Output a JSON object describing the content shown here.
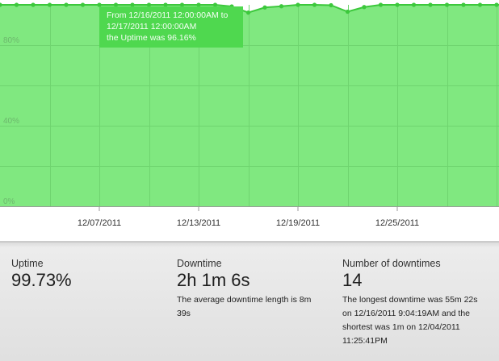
{
  "chart_data": {
    "type": "area",
    "ylabel_ticks": [
      "0%",
      "40%",
      "80%"
    ],
    "ylim": [
      0,
      100
    ],
    "x_tick_labels": [
      "12/07/2011",
      "12/13/2011",
      "12/19/2011",
      "12/25/2011"
    ],
    "x_tick_days": [
      7,
      13,
      19,
      25
    ],
    "x_dates_day_of_december_2011": [
      1,
      2,
      3,
      4,
      5,
      6,
      7,
      8,
      9,
      10,
      11,
      12,
      13,
      14,
      15,
      16,
      17,
      18,
      19,
      20,
      21,
      22,
      23,
      24,
      25,
      26,
      27,
      28,
      29,
      30,
      31
    ],
    "uptime_percent": [
      100,
      100,
      100,
      99.99,
      100,
      100,
      100,
      100,
      100,
      100,
      100,
      100,
      100,
      100,
      99.2,
      96.16,
      98.7,
      99.3,
      100,
      100,
      99.8,
      96.6,
      98.9,
      100,
      100,
      100,
      100,
      100,
      100,
      100,
      100
    ],
    "grid": true,
    "colors": {
      "fill": "#80e880",
      "line": "#3cc83c",
      "grid": "#6fd46f"
    }
  },
  "tooltip": {
    "line1": "From 12/16/2011 12:00:00AM to",
    "line2": "12/17/2011 12:00:00AM",
    "line3": "the Uptime was 96.16%"
  },
  "stats": {
    "uptime": {
      "label": "Uptime",
      "value": "99.73%"
    },
    "downtime": {
      "label": "Downtime",
      "value": "2h 1m 6s",
      "desc": "The average downtime length is 8m 39s"
    },
    "count": {
      "label": "Number of downtimes",
      "value": "14",
      "desc": "The longest downtime was 55m 22s on 12/16/2011 9:04:19AM and the shortest was 1m on 12/04/2011 11:25:41PM"
    }
  }
}
